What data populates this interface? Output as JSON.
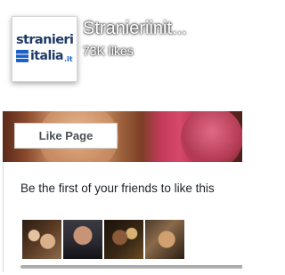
{
  "header": {
    "page_name": "Stranieriinit...",
    "likes": "73K likes",
    "logo": {
      "line1": "stranieri",
      "line2": "italia",
      "suffix": ".it"
    }
  },
  "cover": {
    "like_button_label": "Like Page"
  },
  "social": {
    "friends_text": "Be the first of your friends to like this",
    "friend_avatars": [
      "friend-1",
      "friend-2",
      "friend-3",
      "friend-4"
    ]
  },
  "colors": {
    "logo_text": "#1f3b66",
    "logo_accent": "#1a62c6",
    "body_text": "#1d2129",
    "button_text": "#4b4f56"
  }
}
